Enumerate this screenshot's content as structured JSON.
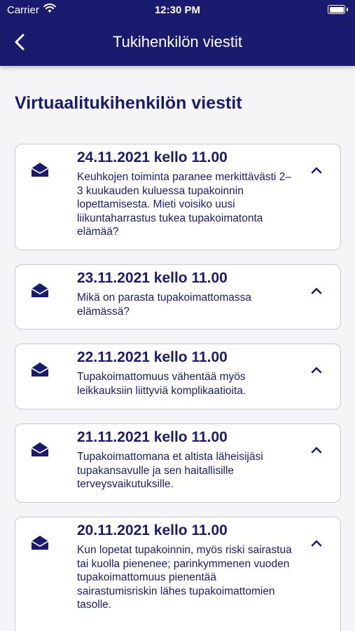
{
  "status_bar": {
    "carrier": "Carrier",
    "time": "12:30 PM"
  },
  "nav": {
    "title": "Tukihenkilön viestit",
    "back_icon": "chevron-left-icon"
  },
  "page": {
    "title": "Virtuaalitukihenkilön viestit"
  },
  "messages": [
    {
      "date": "24.11.2021 kello 11.00",
      "text": "Keuhkojen toiminta paranee merkittävästi 2–3 kuukauden kuluessa tupakoinnin lopettamisesta. Mieti voisiko uusi liikuntaharrastus tukea tupakoimatonta elämää?"
    },
    {
      "date": "23.11.2021 kello 11.00",
      "text": "Mikä on parasta tupakoimattomassa elämässä?"
    },
    {
      "date": "22.11.2021 kello 11.00",
      "text": "Tupakoimattomuus vähentää myös leikkauksiin liittyviä komplikaatioita."
    },
    {
      "date": "21.11.2021 kello 11.00",
      "text": "Tupakoimattomana et altista läheisijäsi tupakansavulle ja sen haitallisille terveysvaikutuksille."
    },
    {
      "date": "20.11.2021 kello 11.00",
      "text": "Kun lopetat tupakoinnin, myös riski sairastua tai kuolla pienenee; parinkymmenen vuoden tupakoimattomuus pienentää sairastumisriskin lähes tupakoimattomien tasolle."
    }
  ],
  "colors": {
    "primary": "#1a1a6e",
    "background": "#f5f5f7",
    "card_border": "#c9c9cf"
  },
  "icons": {
    "message": "open-envelope-icon",
    "expand": "chevron-up-icon"
  }
}
